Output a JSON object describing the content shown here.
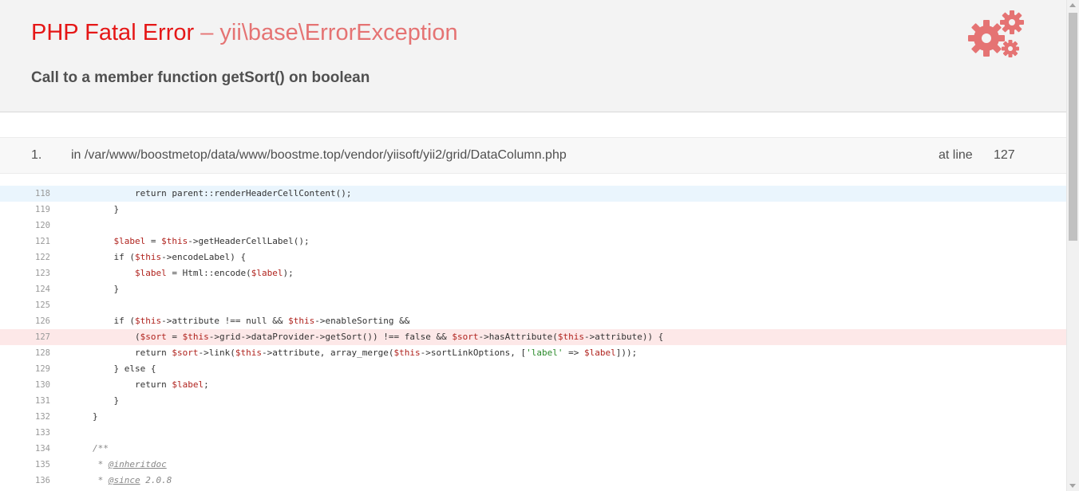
{
  "header": {
    "error_type": "PHP Fatal Error",
    "separator": "–",
    "exception_class": "yii\\base\\ErrorException",
    "message": "Call to a member function getSort() on boolean",
    "icon": "gears-icon",
    "accent_color": "#e51717",
    "icon_color": "#e57373"
  },
  "call_stack": [
    {
      "number": "1.",
      "file": "in /var/www/boostmetop/data/www/boostme.top/vendor/yiisoft/yii2/grid/DataColumn.php",
      "at_line_label": "at line",
      "line": "127"
    }
  ],
  "code_lines": [
    {
      "n": "118"
    },
    {
      "n": "119"
    },
    {
      "n": "120"
    },
    {
      "n": "121"
    },
    {
      "n": "122"
    },
    {
      "n": "123"
    },
    {
      "n": "124"
    },
    {
      "n": "125"
    },
    {
      "n": "126"
    },
    {
      "n": "127"
    },
    {
      "n": "128"
    },
    {
      "n": "129"
    },
    {
      "n": "130"
    },
    {
      "n": "131"
    },
    {
      "n": "132"
    },
    {
      "n": "133"
    },
    {
      "n": "134"
    },
    {
      "n": "135"
    },
    {
      "n": "136"
    }
  ],
  "code": {
    "l118_a": "return parent::renderHeaderCellContent();",
    "l119": "}",
    "l121_var": "$label",
    "l121_b": " = ",
    "l121_this": "$this",
    "l121_c": "->getHeaderCellLabel();",
    "l122_a": "if (",
    "l122_this": "$this",
    "l122_b": "->encodeLabel) {",
    "l123_var": "$label",
    "l123_b": " = Html::encode(",
    "l123_var2": "$label",
    "l123_c": ");",
    "l124": "}",
    "l126_a": "if (",
    "l126_this": "$this",
    "l126_b": "->attribute !== null && ",
    "l126_this2": "$this",
    "l126_c": "->enableSorting &&",
    "l127_a": "(",
    "l127_sort": "$sort",
    "l127_b": " = ",
    "l127_this": "$this",
    "l127_c": "->grid->dataProvider->getSort()) !== false && ",
    "l127_sort2": "$sort",
    "l127_d": "->hasAttribute(",
    "l127_this2": "$this",
    "l127_e": "->attribute)) {",
    "l128_a": "return ",
    "l128_sort": "$sort",
    "l128_b": "->link(",
    "l128_this": "$this",
    "l128_c": "->attribute, array_merge(",
    "l128_this2": "$this",
    "l128_d": "->sortLinkOptions, [",
    "l128_str": "'label'",
    "l128_e": " => ",
    "l128_var": "$label",
    "l128_f": "]));",
    "l129": "} else {",
    "l130_a": "return ",
    "l130_var": "$label",
    "l130_b": ";",
    "l131": "}",
    "l132": "}",
    "l134": "/**",
    "l135_a": " * ",
    "l135_tag": "@inheritdoc",
    "l136_a": " * ",
    "l136_tag": "@since",
    "l136_b": " 2.0.8"
  }
}
